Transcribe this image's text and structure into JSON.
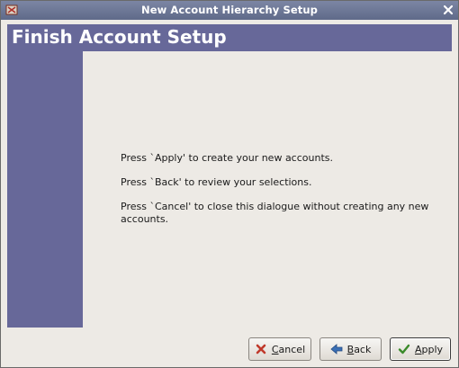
{
  "window": {
    "title": "New Account Hierarchy Setup"
  },
  "header": {
    "title": "Finish Account Setup"
  },
  "messages": [
    "Press `Apply' to create your new accounts.",
    "Press `Back' to review your selections.",
    "Press `Cancel' to close this dialogue without creating any new accounts."
  ],
  "buttons": {
    "cancel": {
      "mnemonic": "C",
      "rest": "ancel"
    },
    "back": {
      "mnemonic": "B",
      "rest": "ack"
    },
    "apply": {
      "mnemonic": "A",
      "rest": "pply"
    }
  },
  "colors": {
    "titlebar": "#6b7595",
    "banner": "#676899",
    "background": "#edeae5",
    "cancel_icon": "#c0392b",
    "back_icon": "#3a6fb5",
    "apply_icon": "#3a8a2a"
  },
  "icons": {
    "app": "app-icon",
    "close": "close-icon",
    "cancel": "cancel-x-icon",
    "back": "arrow-left-icon",
    "apply": "checkmark-icon"
  }
}
